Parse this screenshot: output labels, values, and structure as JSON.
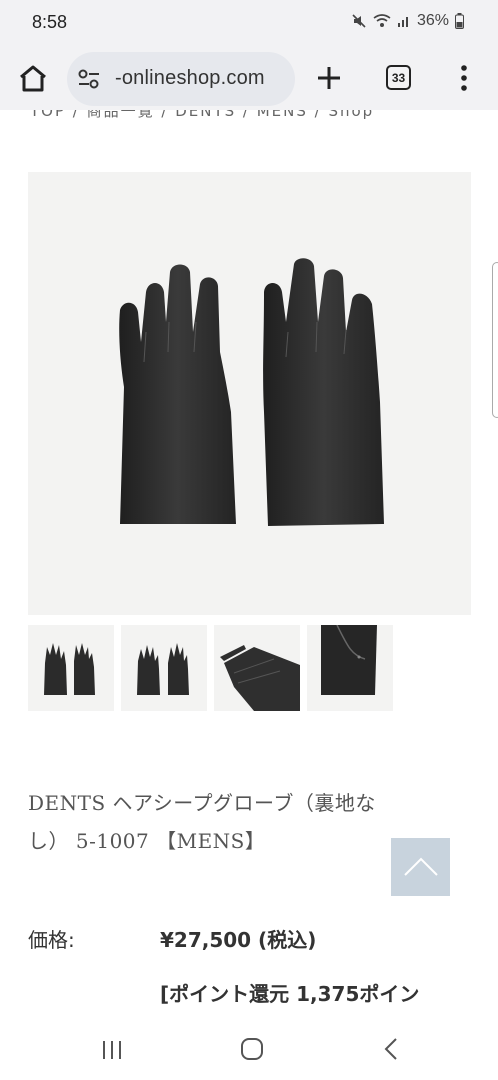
{
  "status": {
    "time": "8:58",
    "battery": "36%"
  },
  "browser": {
    "url": "-onlineshop.com",
    "tab_count": "33"
  },
  "breadcrumb": "TOP / 商品一覧 / DENTS / MENS / Shop",
  "product": {
    "title_line1": "DENTS ヘアシープグローブ（裏地な",
    "title_line2": "し） 5-1007 【MENS】",
    "price_label": "価格:",
    "price_value": "¥27,500 (税込)",
    "points": "[ポイント還元 1,375ポイン"
  },
  "colors": {
    "toolbar_bg": "#f2f2f4",
    "url_pill_bg": "#e6e8ed",
    "back_to_top_bg": "#c8d3dd",
    "glove": "#2b2b2b"
  },
  "icons": {
    "home": "home-icon",
    "tune": "tune-icon",
    "new_tab": "plus-icon",
    "menu": "more-vert-icon",
    "back_to_top": "chevron-up-icon",
    "nav_recent": "recent-apps-icon",
    "nav_home": "nav-home-icon",
    "nav_back": "nav-back-icon"
  }
}
